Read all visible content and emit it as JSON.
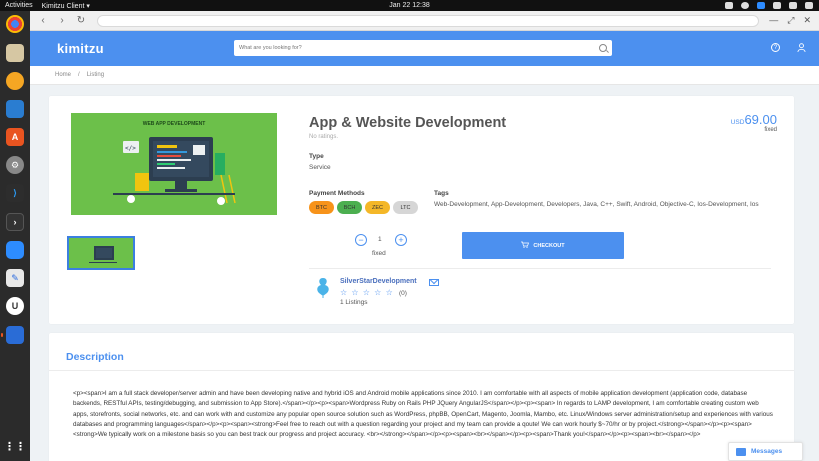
{
  "os": {
    "activities": "Activities",
    "app_name": "Kimitzu Client ▾",
    "clock": "Jan 22  12:38"
  },
  "header": {
    "logo": "kimitzu",
    "search_placeholder": "What are you looking for?"
  },
  "breadcrumb": {
    "home": "Home",
    "separator": "/",
    "current": "Listing"
  },
  "listing": {
    "hero_caption": "WEB APP DEVELOPMENT",
    "title": "App & Website Development",
    "ratings_text": "No ratings.",
    "price_currency": "USD",
    "price_amount": "69.00",
    "price_type": "fixed",
    "type_label": "Type",
    "type_value": "Service",
    "payment_label": "Payment Methods",
    "payment_methods": [
      {
        "label": "BTC",
        "color": "#f7931a"
      },
      {
        "label": "BCH",
        "color": "#4caf50"
      },
      {
        "label": "ZEC",
        "color": "#f4b728"
      },
      {
        "label": "LTC",
        "color": "#d6d6d6"
      }
    ],
    "tags_label": "Tags",
    "tags_value": "Web-Development, App-Development, Developers, Java, C++, Swift, Android, Objective-C, Ios-Development, Ios",
    "quantity": "1",
    "quantity_unit": "fixed",
    "checkout_label": "CHECKOUT"
  },
  "seller": {
    "name": "SilverStarDevelopment",
    "stars": "☆ ☆ ☆ ☆ ☆",
    "rating_count": "(0)",
    "listings": "1 Listings"
  },
  "description": {
    "title": "Description",
    "text": "<p><span>I am a full stack developer/server admin and have been developing native and hybrid iOS and Android mobile applications since 2010. I am comfortable with all aspects of mobile application development (application code, database backends, RESTful APIs, testing/debugging, and submission to App Store).</span></p><p><span>Wordpress Ruby on Rails PHP JQuery AngularJS</span></p><p><span>  In regards to LAMP development, I am comfortable creating custom web apps, storefronts, social networks, etc. and can work with and customize any popular open source solution such as WordPress, phpBB, OpenCart, Magento, Joomla, Mambo, etc. Linux/Windows server administration/setup and experiences with various databases and programming languages</span></p><p><span><strong>Feel free to reach out with a question regarding your project and my team can provide a qoute! We can work hourly $~70/hr or by project.</strong></span></p><p><span><strong>We typically work on a milestone basis so you can best track our progress and project accuracy. <br></strong></span></p><p><span><br></span></p><p><span>Thank you!</span></p><p><span><br></span></p>"
  },
  "messages": {
    "label": "Messages"
  }
}
